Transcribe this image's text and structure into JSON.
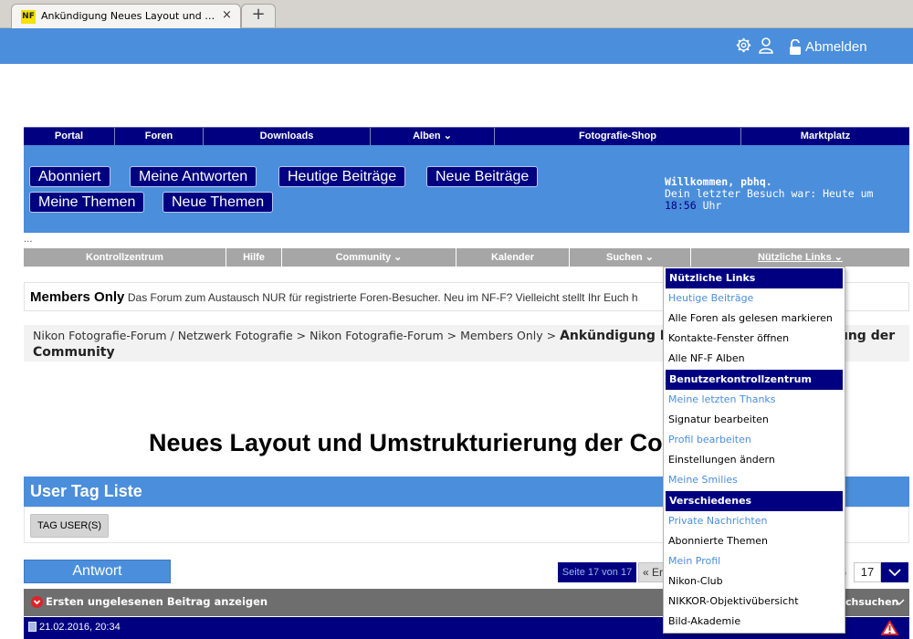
{
  "browser": {
    "tab_title": "Ankündigung Neues Layout und Umstrukturierung der Community",
    "favicon_text": "NF",
    "close_glyph": "×",
    "newtab_glyph": "+"
  },
  "topbar": {
    "logout_label": "Abmelden",
    "color": "#4b8edb"
  },
  "navbar": {
    "items": [
      {
        "label": "Portal"
      },
      {
        "label": "Foren"
      },
      {
        "label": "Downloads"
      },
      {
        "label": "Alben"
      },
      {
        "label": "Fotografie-Shop"
      },
      {
        "label": "Marktplatz"
      }
    ],
    "color": "#000080"
  },
  "welcome": {
    "buttons": [
      "Abonniert",
      "Meine Antworten",
      "Heutige Beiträge",
      "Neue Beiträge",
      "Meine Themen",
      "Neue Themen"
    ],
    "greeting": "Willkommen, pbhq.",
    "last_visit_prefix": "Dein letzter Besuch war: Heute um",
    "last_visit_time": "18:56",
    "last_visit_suffix": "Uhr"
  },
  "ellipsis": "...",
  "subnav": {
    "items": [
      {
        "label": "Kontrollzentrum"
      },
      {
        "label": "Hilfe"
      },
      {
        "label": "Community"
      },
      {
        "label": "Kalender"
      },
      {
        "label": "Suchen"
      },
      {
        "label": "Nützliche Links"
      }
    ]
  },
  "forum_info": {
    "title": "Members Only",
    "description": "Das Forum zum Austausch NUR für registrierte Foren-Besucher. Neu im NF-F? Vielleicht stellt Ihr Euch h"
  },
  "breadcrumb": {
    "path": "Nikon Fotografie-Forum / Netzwerk Fotografie > Nikon Fotografie-Forum > Members Only >",
    "current_part1": "Ankündigung Neu",
    "current_part2": "rung der",
    "current_line2": "Community"
  },
  "thread_title": "Neues Layout und Umstrukturierung der Co",
  "user_tags": {
    "header": "User Tag Liste",
    "button": "TAG USER(S)"
  },
  "reply_button": "Antwort",
  "pagination": {
    "label": "Seite 17 von 17",
    "first": "« Er",
    "prev_fragment": "6",
    "current": "17"
  },
  "unread_bar": {
    "text": "Ersten ungelesenen Beitrag anzeigen",
    "search_fragment": "chsuchen"
  },
  "post": {
    "date": "21.02.2016, 20:34"
  },
  "dropdown": {
    "sections": [
      {
        "header": "Nützliche Links",
        "items": [
          {
            "label": "Heutige Beiträge",
            "link": true
          },
          {
            "label": "Alle Foren als gelesen markieren",
            "link": false
          },
          {
            "label": "Kontakte-Fenster öffnen",
            "link": false
          },
          {
            "label": "Alle NF-F Alben",
            "link": false
          }
        ]
      },
      {
        "header": "Benutzerkontrollzentrum",
        "items": [
          {
            "label": "Meine letzten Thanks",
            "link": true
          },
          {
            "label": "Signatur bearbeiten",
            "link": false
          },
          {
            "label": "Profil bearbeiten",
            "link": true
          },
          {
            "label": "Einstellungen ändern",
            "link": false
          },
          {
            "label": "Meine Smilies",
            "link": true
          }
        ]
      },
      {
        "header": "Verschiedenes",
        "items": [
          {
            "label": "Private Nachrichten",
            "link": true
          },
          {
            "label": "Abonnierte Themen",
            "link": false
          },
          {
            "label": "Mein Profil",
            "link": true
          },
          {
            "label": "Nikon-Club",
            "link": false
          },
          {
            "label": "NIKKOR-Objektivübersicht",
            "link": false
          },
          {
            "label": "Bild-Akademie",
            "link": false
          }
        ]
      }
    ]
  }
}
